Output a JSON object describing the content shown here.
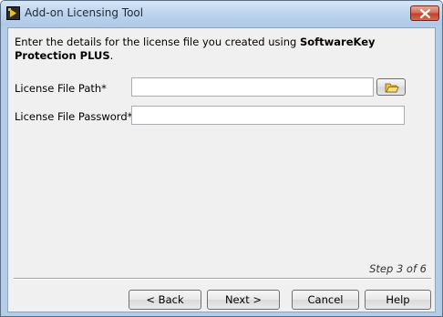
{
  "window": {
    "title": "Add-on Licensing Tool",
    "close_symbol": "close-icon"
  },
  "intro": {
    "text_prefix": "Enter the details for the license file you created using ",
    "text_bold": "SoftwareKey Protection PLUS",
    "text_suffix": "."
  },
  "fields": {
    "path_label": "License File Path*",
    "path_value": "",
    "password_label": "License File Password*",
    "password_value": "",
    "browse_icon": "folder-open-icon"
  },
  "status": {
    "step_text": "Step 3 of 6"
  },
  "buttons": {
    "back": "< Back",
    "next": "Next >",
    "cancel": "Cancel",
    "help": "Help"
  },
  "colors": {
    "titlebar": "#bcd3ec",
    "client_bg": "#f0f0f0",
    "close_button": "#c1402a"
  }
}
